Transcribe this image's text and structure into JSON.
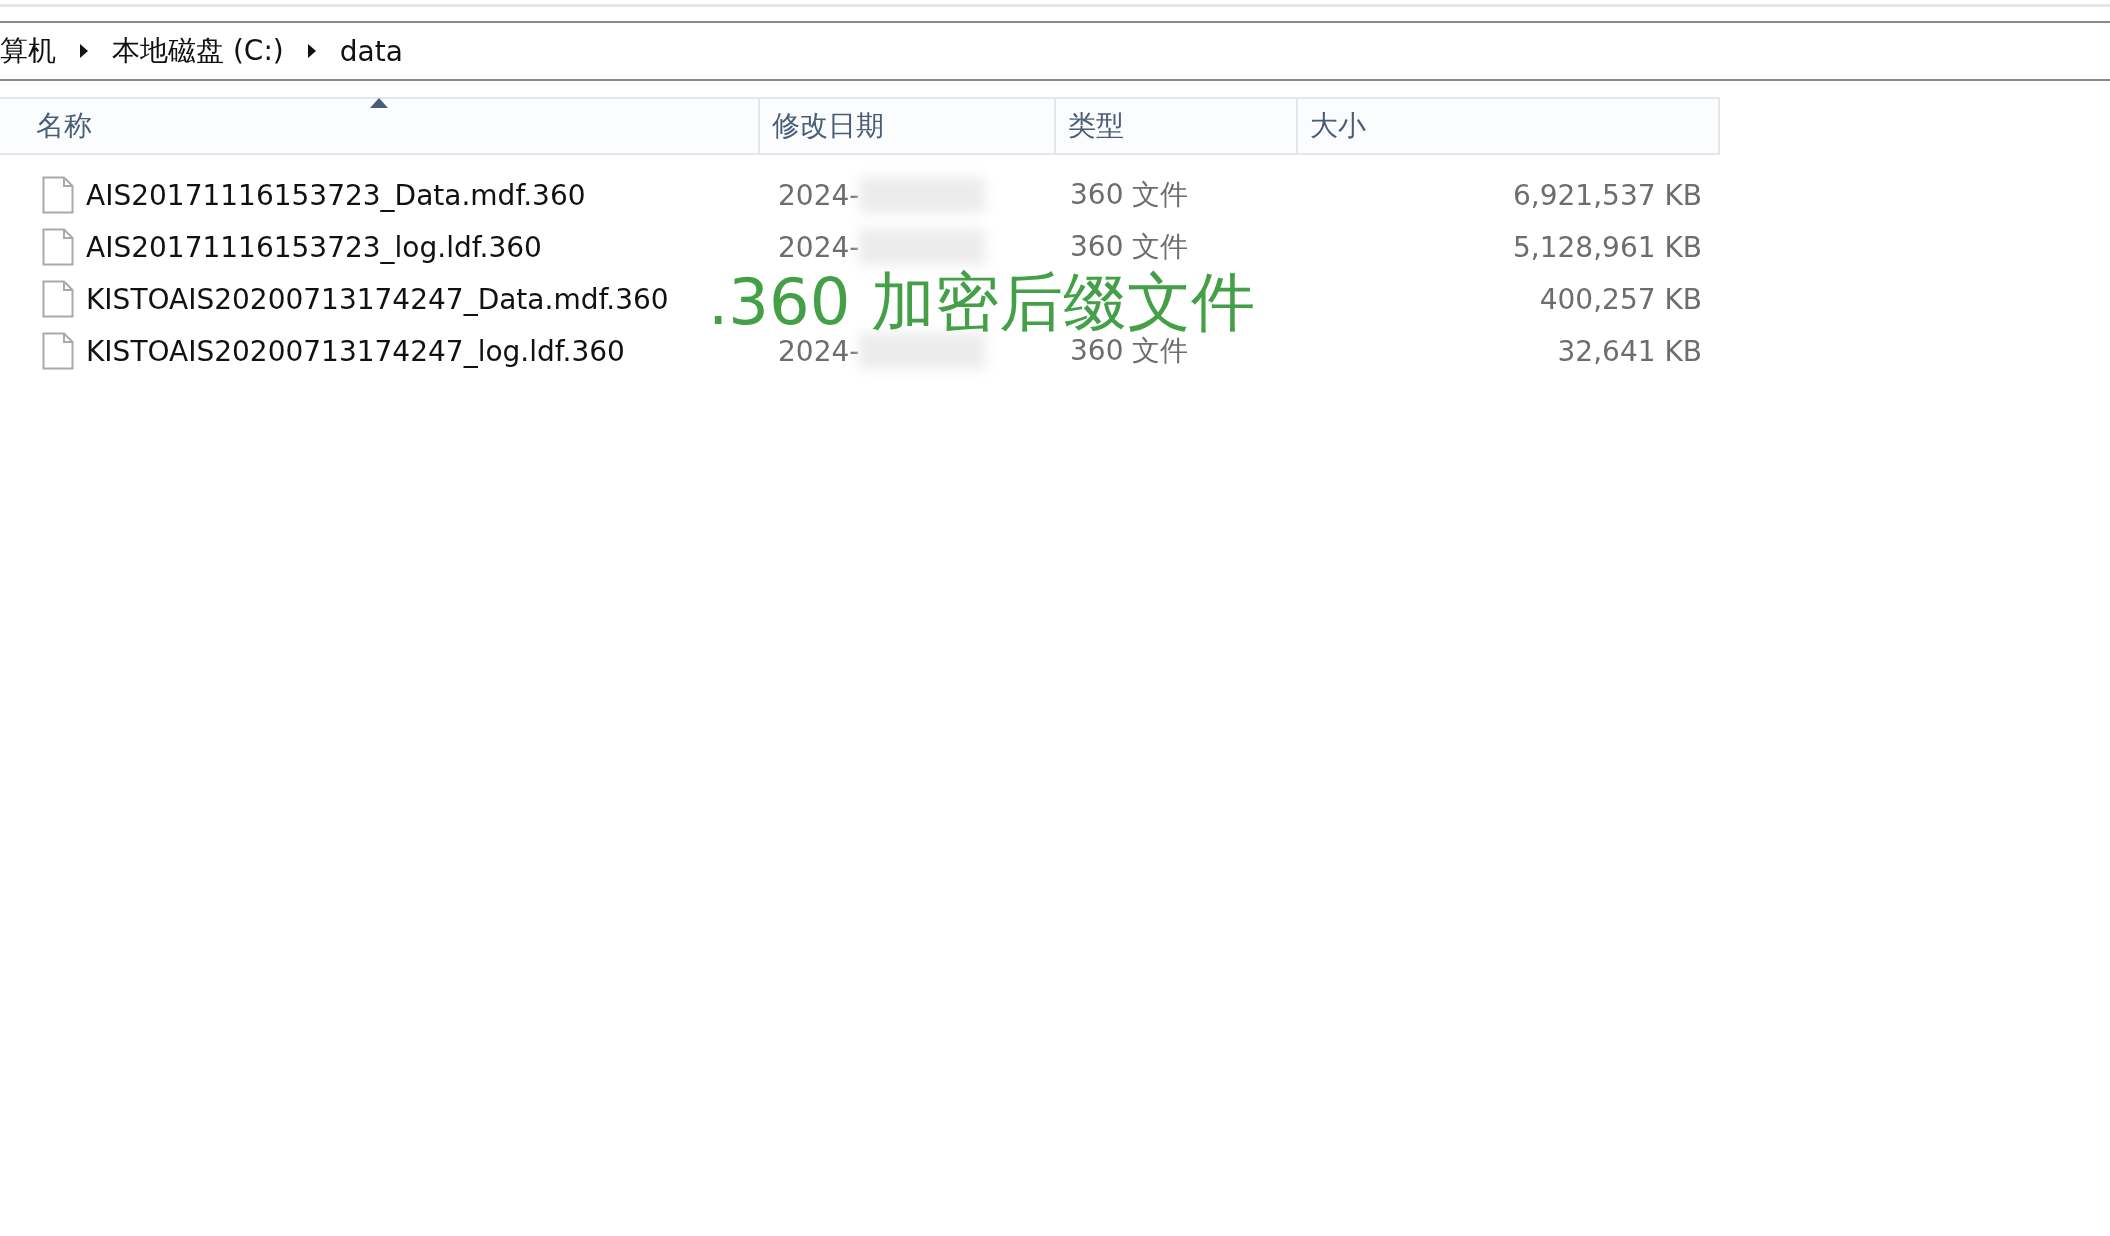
{
  "breadcrumb": [
    "算机",
    "本地磁盘 (C:)",
    "data"
  ],
  "columns": [
    {
      "label": "名称",
      "sorted": true
    },
    {
      "label": "修改日期",
      "sorted": false
    },
    {
      "label": "类型",
      "sorted": false
    },
    {
      "label": "大小",
      "sorted": false
    }
  ],
  "rows": [
    {
      "name": "AIS20171116153723_Data.mdf.360",
      "date": "2024-",
      "type": "360 文件",
      "size": "6,921,537 KB"
    },
    {
      "name": "AIS20171116153723_log.ldf.360",
      "date": "2024-",
      "type": "360 文件",
      "size": "5,128,961 KB"
    },
    {
      "name": "KISTOAIS20200713174247_Data.mdf.360",
      "size": "400,257 KB"
    },
    {
      "name": "KISTOAIS20200713174247_log.ldf.360",
      "date": "2024-",
      "type": "360 文件",
      "size": "32,641 KB"
    }
  ],
  "annotation": ".360 加密后缀文件"
}
